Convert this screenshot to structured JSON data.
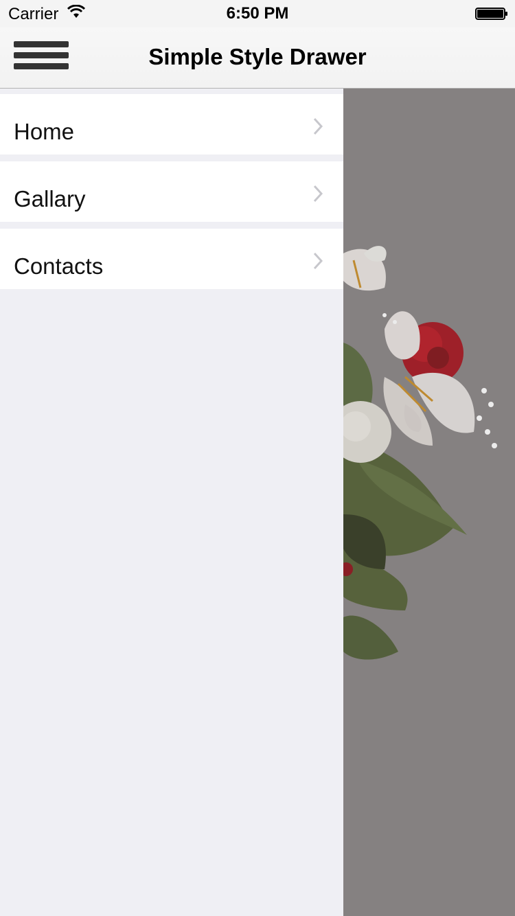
{
  "status_bar": {
    "carrier": "Carrier",
    "time": "6:50 PM",
    "wifi_icon": "wifi-icon",
    "battery_icon": "battery-icon"
  },
  "nav_bar": {
    "title": "Simple Style Drawer",
    "menu_icon": "hamburger-menu-icon"
  },
  "drawer": {
    "items": [
      {
        "label": "Home",
        "icon": "chevron-right-icon"
      },
      {
        "label": "Gallary",
        "icon": "chevron-right-icon"
      },
      {
        "label": "Contacts",
        "icon": "chevron-right-icon"
      }
    ]
  },
  "content": {
    "image_icon": "flower-bouquet-image"
  },
  "colors": {
    "drawer_background": "#efeff4",
    "row_background": "#ffffff",
    "overlay": "#858181",
    "chevron": "#c7c7cc",
    "rose": "#a3101a",
    "leaf": "#4f5d31"
  }
}
